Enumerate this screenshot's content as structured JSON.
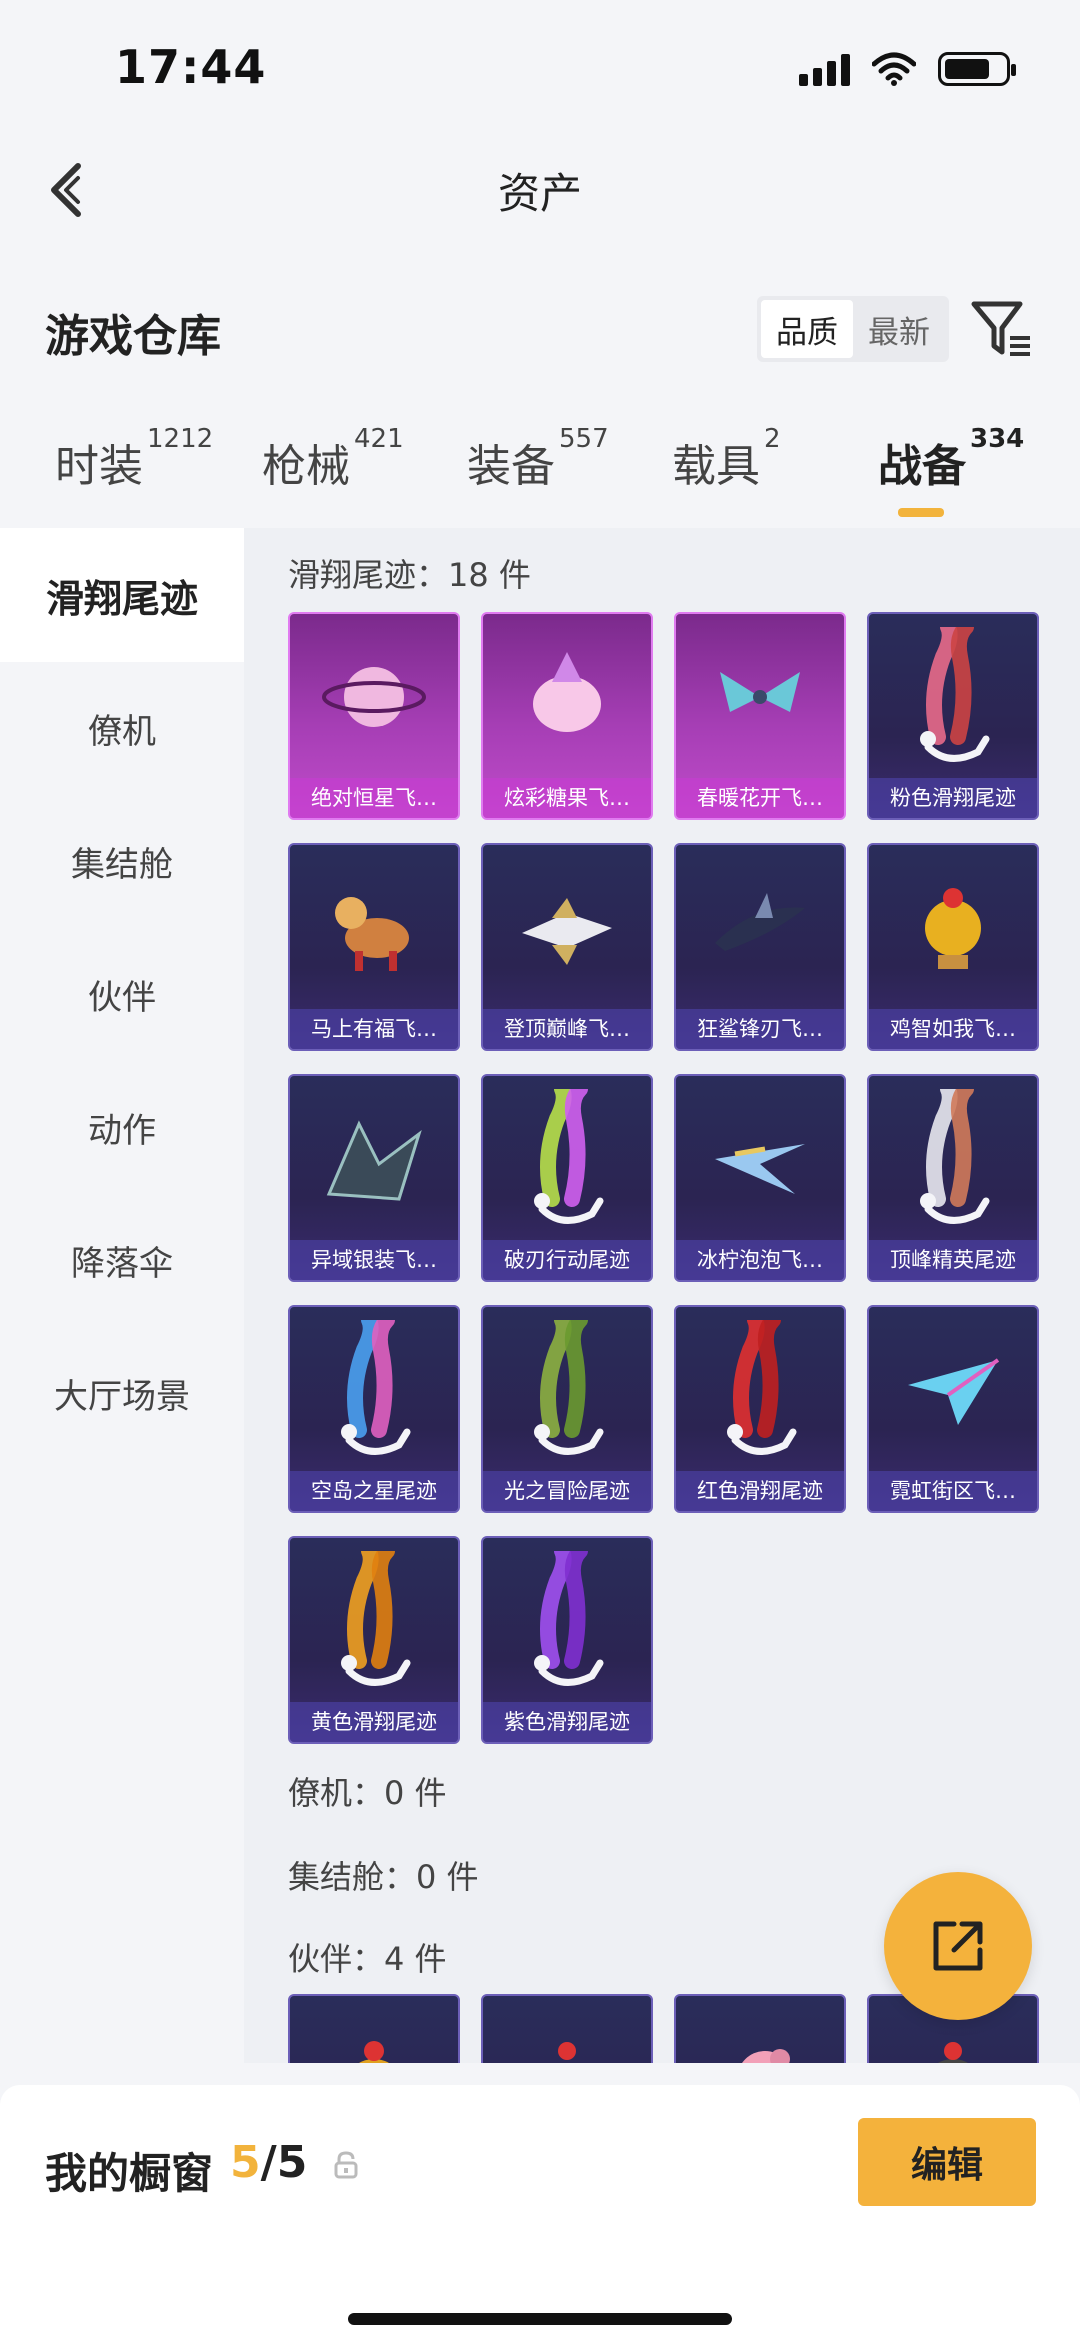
{
  "status": {
    "time": "17:44"
  },
  "nav": {
    "title": "资产"
  },
  "header": {
    "title": "游戏仓库",
    "sort_quality": "品质",
    "sort_latest": "最新"
  },
  "tabs": [
    {
      "label": "时装",
      "count": "1212"
    },
    {
      "label": "枪械",
      "count": "421"
    },
    {
      "label": "装备",
      "count": "557"
    },
    {
      "label": "载具",
      "count": "2"
    },
    {
      "label": "战备",
      "count": "334"
    }
  ],
  "sidebar": [
    {
      "label": "滑翔尾迹"
    },
    {
      "label": "僚机"
    },
    {
      "label": "集结舱"
    },
    {
      "label": "伙伴"
    },
    {
      "label": "动作"
    },
    {
      "label": "降落伞"
    },
    {
      "label": "大厅场景"
    }
  ],
  "groups": {
    "trails_label": "滑翔尾迹：18 件",
    "wingman_label": "僚机：0 件",
    "pod_label": "集结舱：0 件",
    "partner_label": "伙伴：4 件"
  },
  "trail_items": [
    {
      "name": "绝对恒星飞…",
      "icon": "planet-icon"
    },
    {
      "name": "炫彩糖果飞…",
      "icon": "candy-icon"
    },
    {
      "name": "春暖花开飞…",
      "icon": "butterfly-icon"
    },
    {
      "name": "粉色滑翔尾迹",
      "icon": "smoke-trail-icon"
    },
    {
      "name": "马上有福飞…",
      "icon": "horse-icon"
    },
    {
      "name": "登顶巅峰飞…",
      "icon": "jet-icon"
    },
    {
      "name": "狂鲨锋刃飞…",
      "icon": "shark-icon"
    },
    {
      "name": "鸡智如我飞…",
      "icon": "chicken-icon"
    },
    {
      "name": "异域银装飞…",
      "icon": "dragon-icon"
    },
    {
      "name": "破刃行动尾迹",
      "icon": "smoke-trail-icon"
    },
    {
      "name": "冰柠泡泡飞…",
      "icon": "plane-icon"
    },
    {
      "name": "顶峰精英尾迹",
      "icon": "smoke-trail-icon"
    },
    {
      "name": "空岛之星尾迹",
      "icon": "smoke-trail-icon"
    },
    {
      "name": "光之冒险尾迹",
      "icon": "smoke-trail-icon"
    },
    {
      "name": "红色滑翔尾迹",
      "icon": "smoke-trail-icon"
    },
    {
      "name": "霓虹街区飞…",
      "icon": "paper-plane-icon"
    },
    {
      "name": "黄色滑翔尾迹",
      "icon": "smoke-trail-icon"
    },
    {
      "name": "紫色滑翔尾迹",
      "icon": "smoke-trail-icon"
    }
  ],
  "colors": {
    "accent": "#f2b33c",
    "card_bg": "#2b2452",
    "card_rare": "#a63eb5"
  },
  "bottom": {
    "label": "我的橱窗",
    "current": "5",
    "total": "/5",
    "edit": "编辑"
  }
}
